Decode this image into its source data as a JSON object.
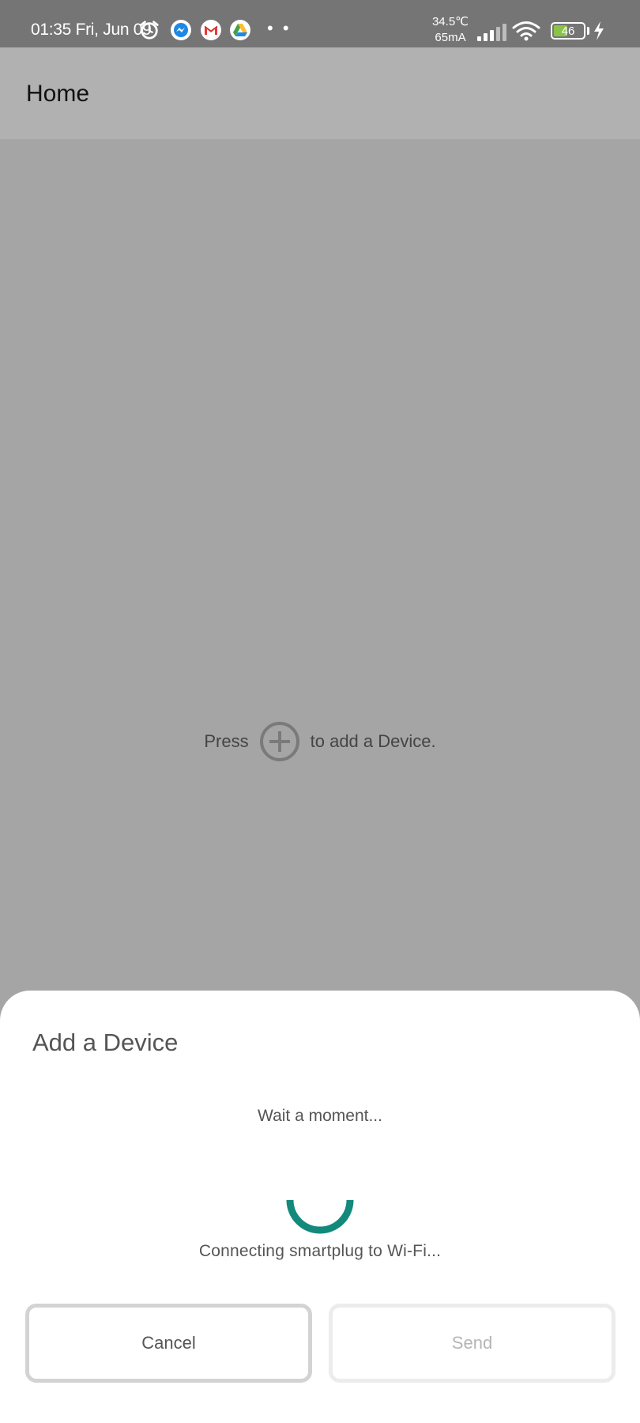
{
  "status_bar": {
    "time": "01:35 Fri, Jun 09",
    "icons": [
      "alarm-icon",
      "messenger-icon",
      "gmail-icon",
      "google-drive-icon"
    ],
    "more": "• •",
    "temperature": "34.5℃",
    "current": "65mA",
    "battery": "46",
    "battery_percent": 46,
    "battery_color": "#8bc34a"
  },
  "app_bar": {
    "title": "Home"
  },
  "empty_state": {
    "before": "Press",
    "after": "to add a Device."
  },
  "dialog": {
    "title": "Add a Device",
    "wait_text": "Wait a moment...",
    "status_text": "Connecting smartplug to Wi-Fi...",
    "spinner_color": "#12897b",
    "cancel_label": "Cancel",
    "send_label": "Send"
  }
}
